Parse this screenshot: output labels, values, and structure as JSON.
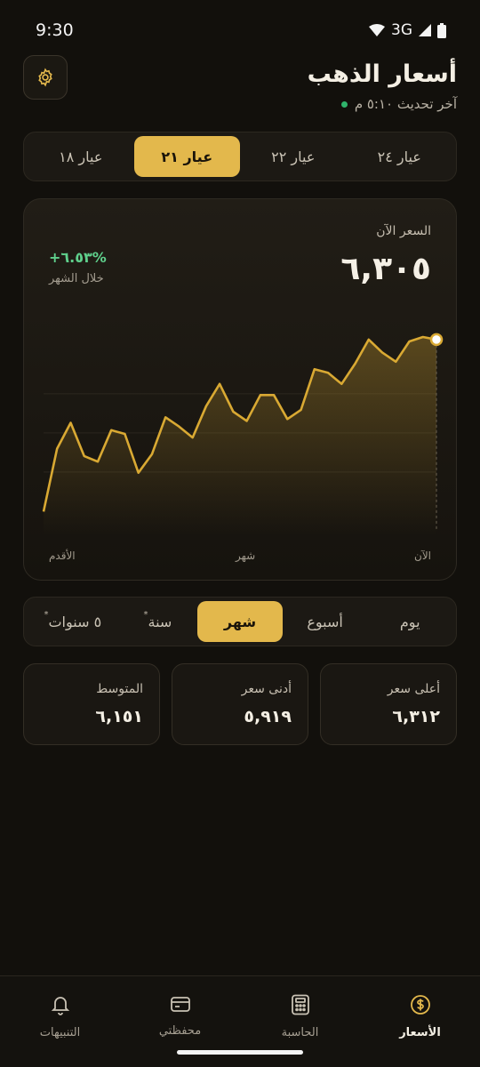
{
  "status_bar": {
    "time": "9:30",
    "network": "3G"
  },
  "header": {
    "title": "أسعار الذهب",
    "subtitle": "آخر تحديث ٥:١٠ م"
  },
  "karats": {
    "items": [
      {
        "label": "عيار ٢٤"
      },
      {
        "label": "عيار ٢٢"
      },
      {
        "label": "عيار ٢١"
      },
      {
        "label": "عيار ١٨"
      }
    ],
    "selected": "عيار ٢١"
  },
  "price": {
    "label": "السعر الآن",
    "value": "٦,٣٠٥",
    "change": "+٦.٥٣%",
    "change_label": "خلال الشهر"
  },
  "chart_data": {
    "type": "line",
    "series": [
      {
        "values": [
          5840,
          6010,
          6080,
          5990,
          5975,
          6060,
          6050,
          5945,
          5995,
          6095,
          6070,
          6040,
          6125,
          6185,
          6110,
          6085,
          6155,
          6155,
          6090,
          6115,
          6225,
          6215,
          6185,
          6240,
          6305,
          6270,
          6245,
          6300,
          6312,
          6305
        ]
      }
    ],
    "x_tick_labels": [
      "الأقدم",
      "شهر",
      "الآن"
    ],
    "ylim": [
      5800,
      6360
    ],
    "grid": true,
    "line_color": "#d9a933"
  },
  "ranges": {
    "items": [
      {
        "label": "يوم",
        "pro": ""
      },
      {
        "label": "أسبوع",
        "pro": ""
      },
      {
        "label": "شهر",
        "pro": ""
      },
      {
        "label": "سنة",
        "pro": "*"
      },
      {
        "label": "٥ سنوات",
        "pro": "*"
      }
    ],
    "selected": "شهر"
  },
  "stats": [
    {
      "label": "أعلى سعر",
      "value": "٦,٣١٢"
    },
    {
      "label": "أدنى سعر",
      "value": "٥,٩١٩"
    },
    {
      "label": "المتوسط",
      "value": "٦,١٥١"
    }
  ],
  "nav": {
    "items": [
      {
        "label": "الأسعار",
        "icon": "dollar-coin-icon"
      },
      {
        "label": "الحاسبة",
        "icon": "calculator-icon"
      },
      {
        "label": "محفظتي",
        "icon": "wallet-icon"
      },
      {
        "label": "التنبيهات",
        "icon": "bell-icon"
      }
    ],
    "selected": "الأسعار"
  },
  "colors": {
    "accent": "#e3b84c",
    "background": "#12100c",
    "positive": "#5fd08c"
  }
}
